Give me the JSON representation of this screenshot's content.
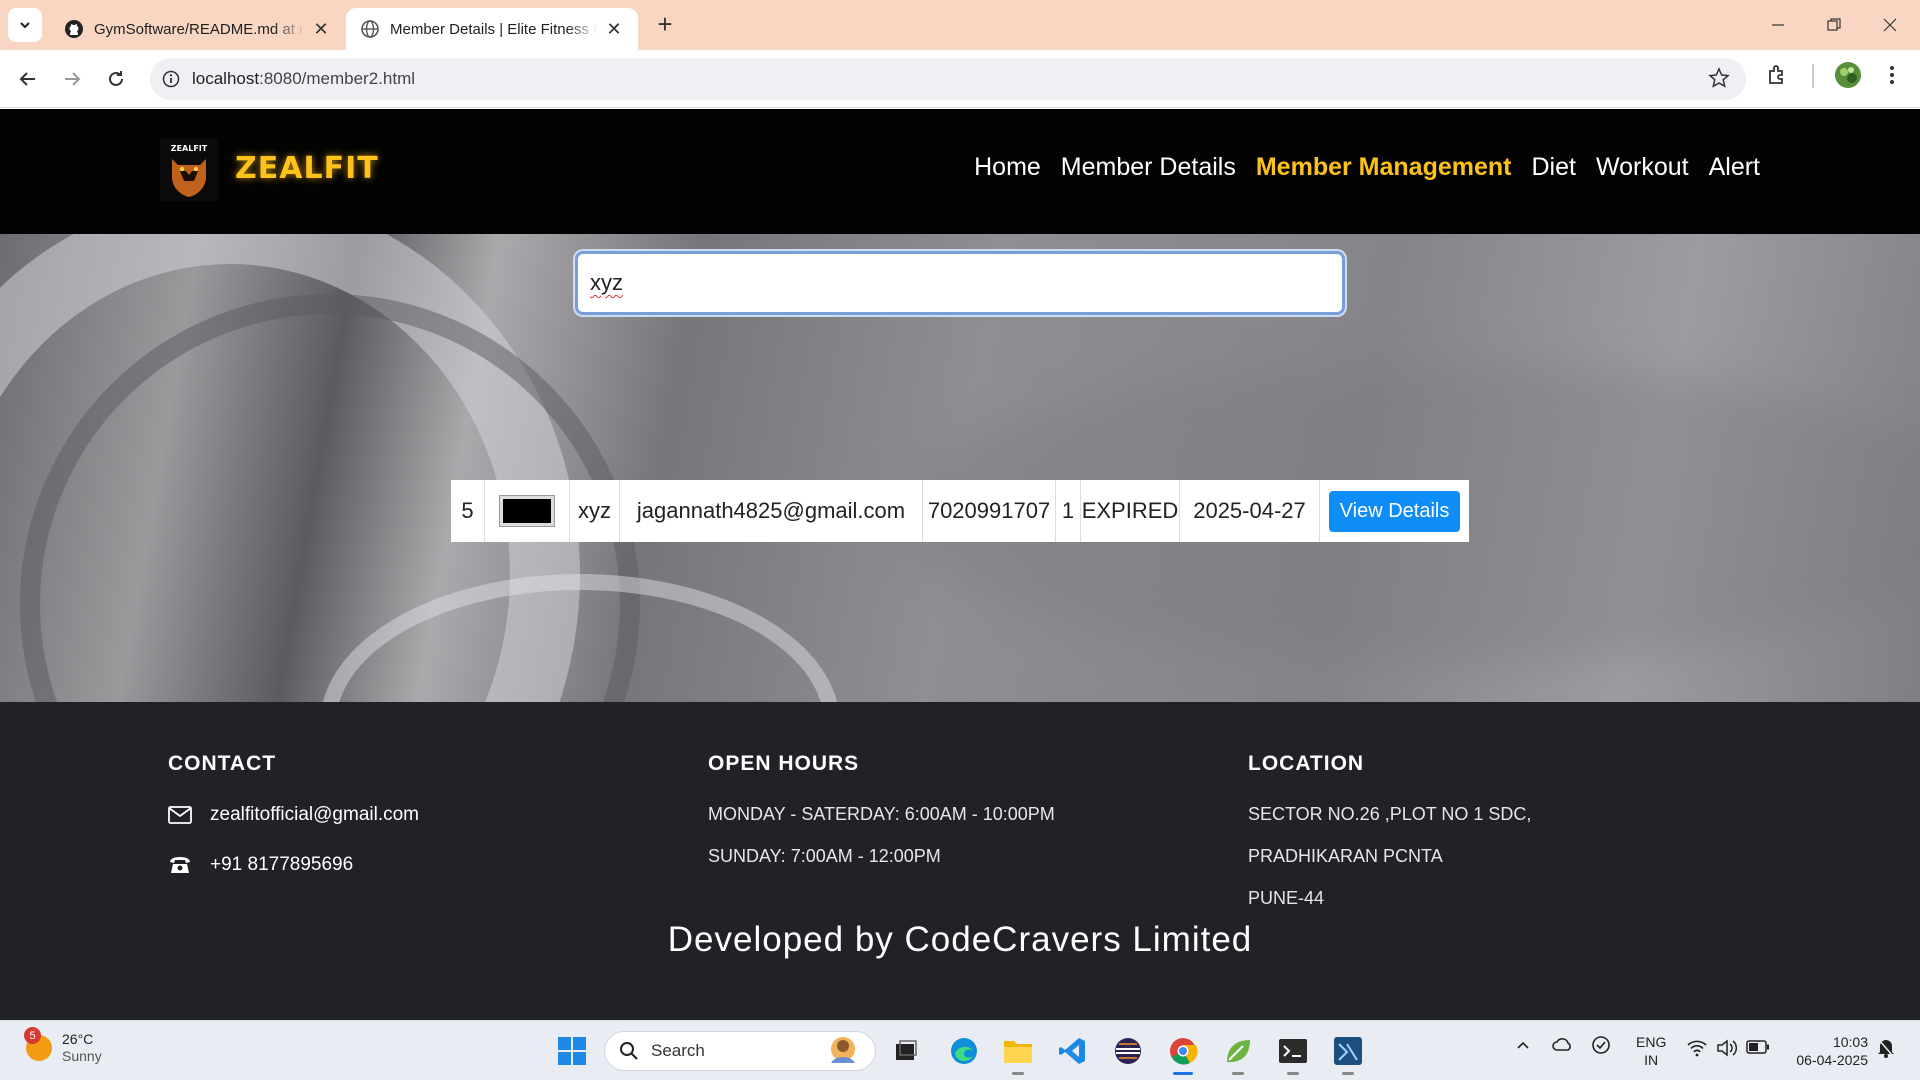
{
  "browser": {
    "tabs": [
      {
        "title": "GymSoftware/README.md at m",
        "active": false
      },
      {
        "title": "Member Details | Elite Fitness C",
        "active": true
      }
    ],
    "url_host": "localhost",
    "url_path": ":8080/member2.html"
  },
  "site": {
    "brand": "ZEALFIT",
    "nav": [
      "Home",
      "Member Details",
      "Member Management",
      "Diet",
      "Workout",
      "Alert"
    ],
    "active_nav": "Member Management",
    "accent_color": "#ffc21a"
  },
  "search": {
    "value": "xyz"
  },
  "result": {
    "id": "5",
    "name": "xyz",
    "email": "jagannath4825@gmail.com",
    "phone": "7020991707",
    "plan": "1",
    "status": "EXPIRED",
    "date": "2025-04-27",
    "button_label": "View Details",
    "button_color": "#0d8df5"
  },
  "footer": {
    "contact_heading": "CONTACT",
    "email": "zealfitofficial@gmail.com",
    "phone": "+91 8177895696",
    "hours_heading": "OPEN HOURS",
    "hours_weekday": "MONDAY - SATERDAY: 6:00AM - 10:00PM",
    "hours_sunday": "SUNDAY: 7:00AM - 12:00PM",
    "location_heading": "LOCATION",
    "location_line1": "SECTOR NO.26 ,PLOT NO 1 SDC,",
    "location_line2": "PRADHIKARAN PCNTA",
    "location_line3": "PUNE-44",
    "developer": "Developed by CodeCravers Limited"
  },
  "taskbar": {
    "weather_badge": "5",
    "temperature": "26°C",
    "condition": "Sunny",
    "search_label": "Search",
    "lang_top": "ENG",
    "lang_bottom": "IN",
    "time": "10:03",
    "date": "06-04-2025"
  }
}
